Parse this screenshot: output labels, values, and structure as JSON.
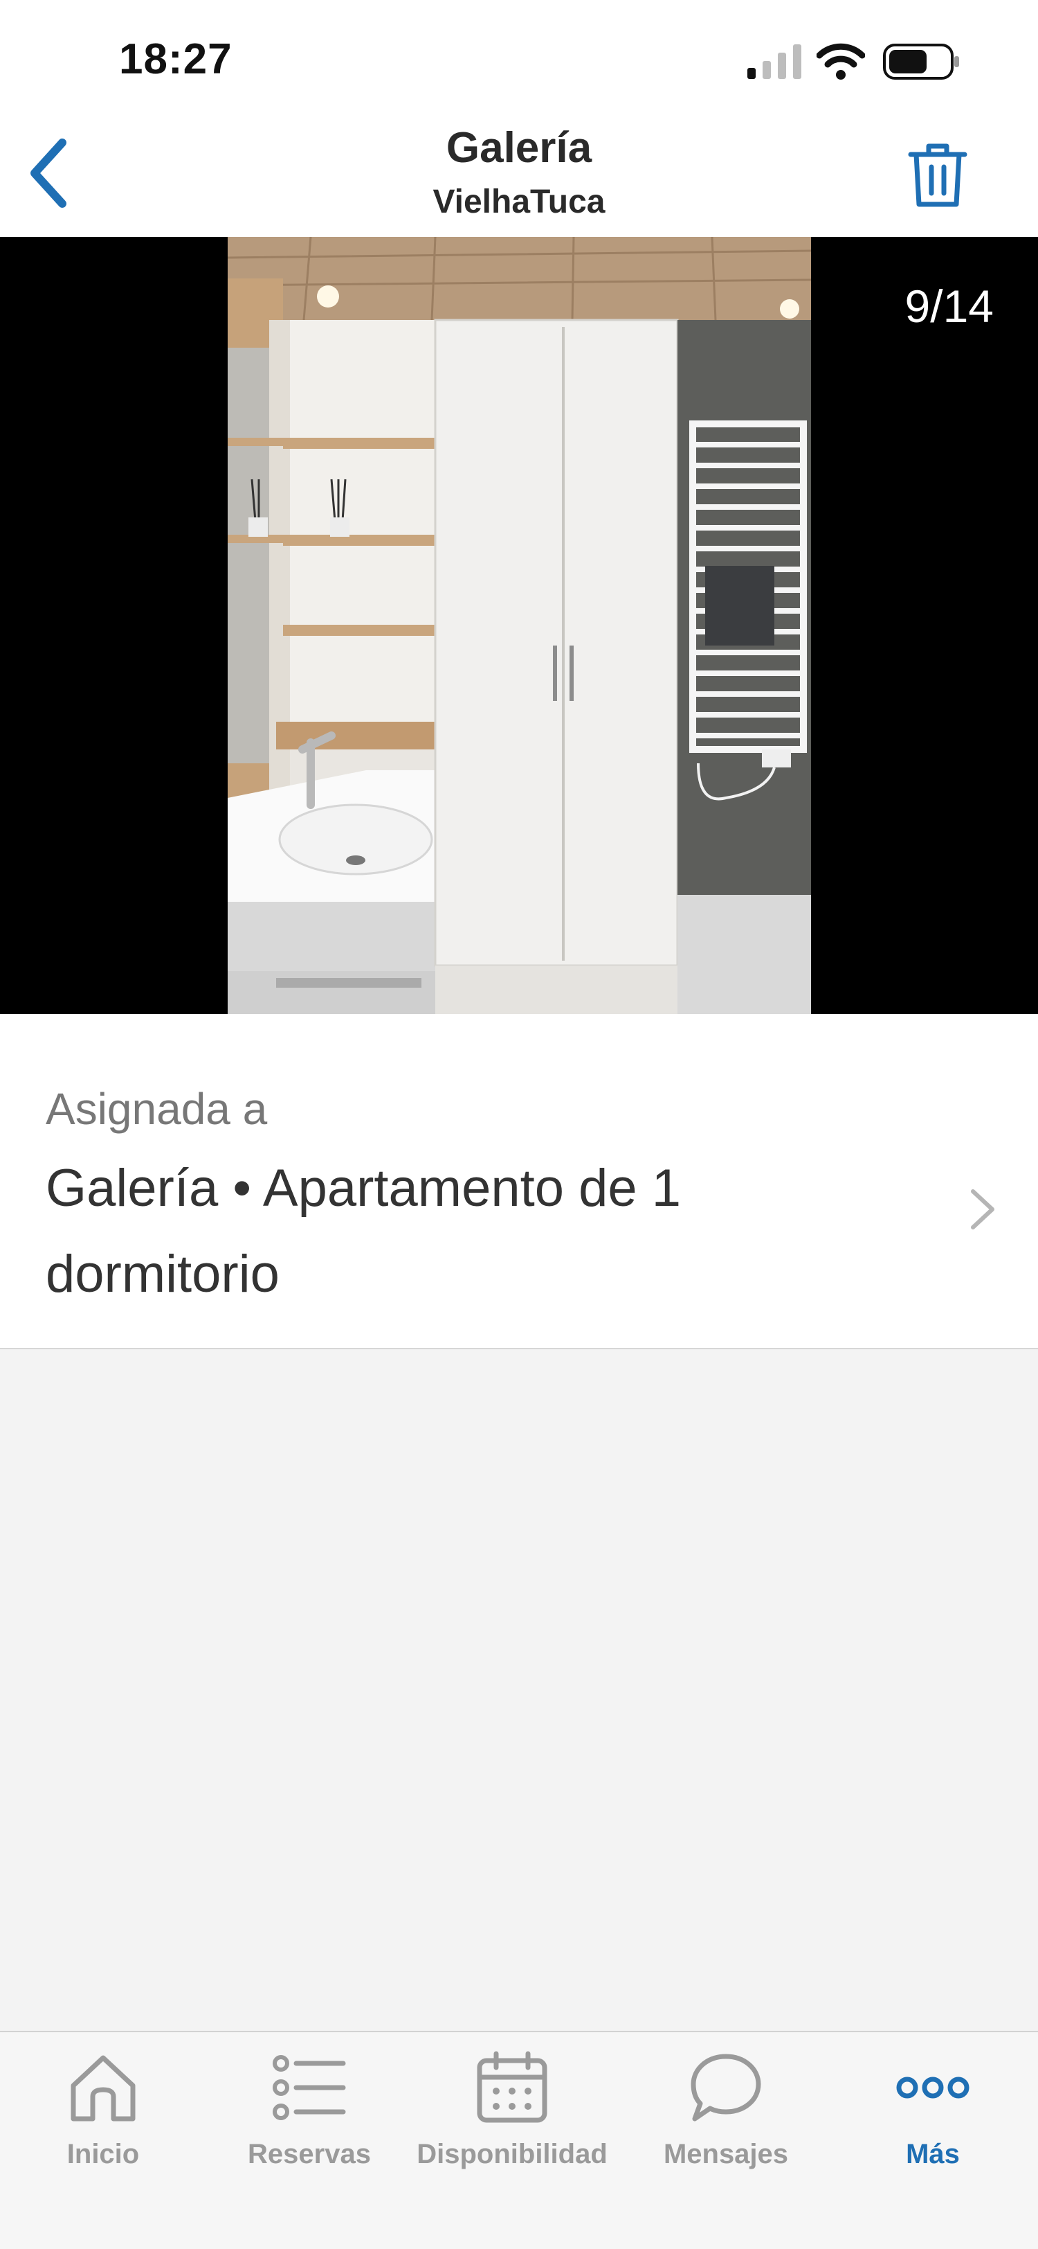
{
  "status_bar": {
    "time": "18:27"
  },
  "nav": {
    "title": "Galería",
    "subtitle": "VielhaTuca"
  },
  "photo": {
    "counter": "9/14"
  },
  "assigned": {
    "label": "Asignada a",
    "value": "Galería • Apartamento de 1 dormitorio"
  },
  "tabs": [
    {
      "label": "Inicio",
      "icon": "home-icon",
      "active": false
    },
    {
      "label": "Reservas",
      "icon": "list-icon",
      "active": false
    },
    {
      "label": "Disponibilidad",
      "icon": "calendar-icon",
      "active": false
    },
    {
      "label": "Mensajes",
      "icon": "chat-icon",
      "active": false
    },
    {
      "label": "Más",
      "icon": "more-icon",
      "active": true
    }
  ],
  "colors": {
    "accent": "#1f6fb4",
    "inactive": "#9a9a9a"
  }
}
